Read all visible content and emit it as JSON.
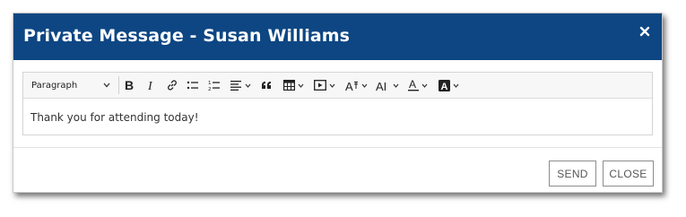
{
  "dialog": {
    "title": "Private Message - Susan Williams"
  },
  "toolbar": {
    "format_value": "Paragraph",
    "buttons": [
      {
        "icon": "bold-icon"
      },
      {
        "icon": "italic-icon"
      },
      {
        "icon": "link-icon"
      },
      {
        "icon": "bullet-list-icon"
      },
      {
        "icon": "numbered-list-icon"
      },
      {
        "icon": "align-icon"
      },
      {
        "icon": "blockquote-icon"
      },
      {
        "icon": "table-icon"
      },
      {
        "icon": "media-icon"
      },
      {
        "icon": "font-size-icon"
      },
      {
        "icon": "font-family-icon"
      },
      {
        "icon": "text-color-icon"
      },
      {
        "icon": "background-color-icon"
      }
    ]
  },
  "editor": {
    "content": "Thank you for attending today!"
  },
  "footer": {
    "send_label": "SEND",
    "close_label": "CLOSE"
  },
  "colors": {
    "header_bg": "#0d4683",
    "header_text": "#ffffff",
    "button_border": "#8c8c8c"
  }
}
